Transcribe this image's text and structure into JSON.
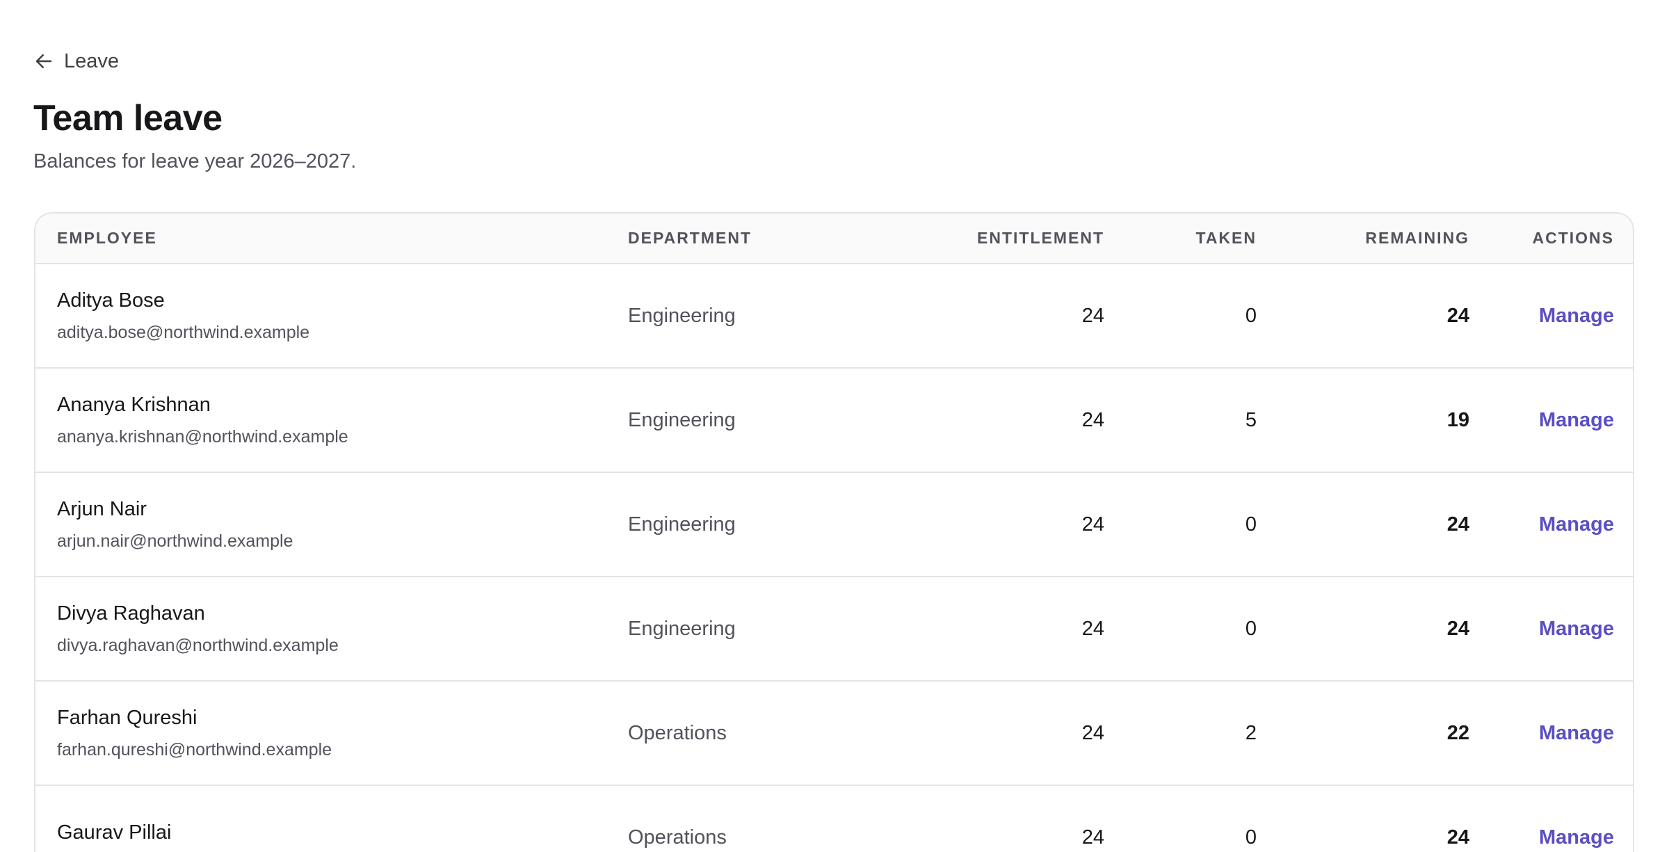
{
  "nav": {
    "back_label": "Leave"
  },
  "page": {
    "title": "Team leave",
    "subtitle": "Balances for leave year 2026–2027."
  },
  "table": {
    "columns": {
      "employee": "Employee",
      "department": "Department",
      "entitlement": "Entitlement",
      "taken": "Taken",
      "remaining": "Remaining",
      "actions": "Actions"
    },
    "rows": [
      {
        "name": "Aditya Bose",
        "email": "aditya.bose@northwind.example",
        "department": "Engineering",
        "entitlement": "24",
        "taken": "0",
        "remaining": "24",
        "action": "Manage"
      },
      {
        "name": "Ananya Krishnan",
        "email": "ananya.krishnan@northwind.example",
        "department": "Engineering",
        "entitlement": "24",
        "taken": "5",
        "remaining": "19",
        "action": "Manage"
      },
      {
        "name": "Arjun Nair",
        "email": "arjun.nair@northwind.example",
        "department": "Engineering",
        "entitlement": "24",
        "taken": "0",
        "remaining": "24",
        "action": "Manage"
      },
      {
        "name": "Divya Raghavan",
        "email": "divya.raghavan@northwind.example",
        "department": "Engineering",
        "entitlement": "24",
        "taken": "0",
        "remaining": "24",
        "action": "Manage"
      },
      {
        "name": "Farhan Qureshi",
        "email": "farhan.qureshi@northwind.example",
        "department": "Operations",
        "entitlement": "24",
        "taken": "2",
        "remaining": "22",
        "action": "Manage"
      },
      {
        "name": "Gaurav Pillai",
        "email": "",
        "department": "Operations",
        "entitlement": "24",
        "taken": "0",
        "remaining": "24",
        "action": "Manage"
      }
    ]
  },
  "colors": {
    "accent": "#5b4fc4",
    "border": "#e4e4e7",
    "muted_text": "#52525b"
  }
}
